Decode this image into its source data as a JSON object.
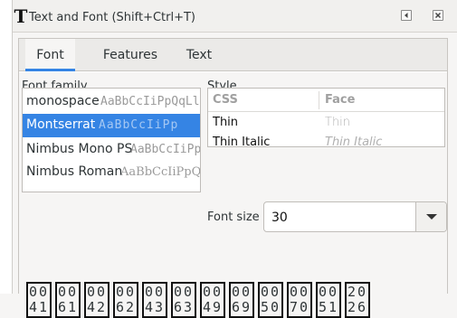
{
  "window": {
    "title": "Text and Font (Shift+Ctrl+T)",
    "icon": "text-tool-icon"
  },
  "tabs": [
    {
      "label": "Font",
      "active": true
    },
    {
      "label": "Features",
      "active": false
    },
    {
      "label": "Text",
      "active": false
    }
  ],
  "font_family": {
    "label": "Font family",
    "items": [
      {
        "name": "monospace",
        "sample": "AaBbCcIiPpQqLl",
        "selected": false
      },
      {
        "name": "Montserrat",
        "sample": "AaBbCcIiPp",
        "selected": true
      },
      {
        "name": "Nimbus Mono PS",
        "sample": "AaBbCcIiPp",
        "selected": false
      },
      {
        "name": "Nimbus Roman",
        "sample": "AaBbCcIiPpQq",
        "selected": false
      }
    ]
  },
  "style": {
    "label": "Style",
    "col_css": "CSS",
    "col_face": "Face",
    "rows": [
      {
        "css": "Thin",
        "face": "Thin",
        "italic": false
      },
      {
        "css": "Thin Italic",
        "face": "Thin Italic",
        "italic": true
      }
    ]
  },
  "font_size": {
    "label": "Font size",
    "value": "30"
  },
  "preview_glyphs": [
    [
      "00",
      "41"
    ],
    [
      "00",
      "61"
    ],
    [
      "00",
      "42"
    ],
    [
      "00",
      "62"
    ],
    [
      "00",
      "43"
    ],
    [
      "00",
      "63"
    ],
    [
      "00",
      "49"
    ],
    [
      "00",
      "69"
    ],
    [
      "00",
      "50"
    ],
    [
      "00",
      "70"
    ],
    [
      "00",
      "51"
    ],
    [
      "20",
      "26"
    ]
  ],
  "colors": {
    "accent": "#3584e4",
    "background": "#f6f5f4"
  }
}
